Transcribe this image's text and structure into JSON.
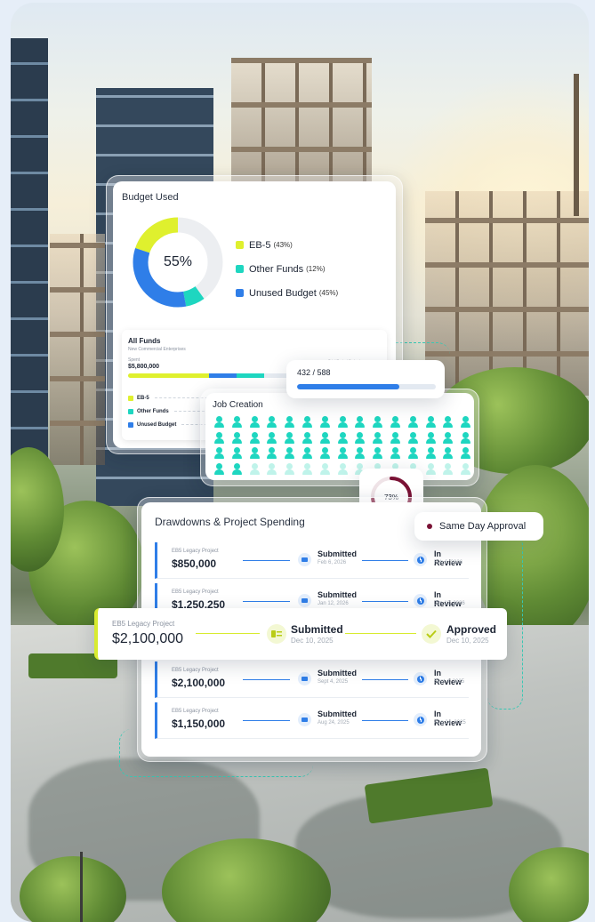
{
  "colors": {
    "eb5": "#dff02e",
    "other_funds": "#1ed6c0",
    "unused": "#2f7ee8",
    "donut_track": "#eceef1",
    "ring_progress": "#7a1235",
    "approved_accent": "#d8eb2f"
  },
  "budget": {
    "title": "Budget Used",
    "center_label": "55%",
    "legend": [
      {
        "label": "EB-5",
        "pct": "(43%)",
        "value": 43,
        "color": "#dff02e"
      },
      {
        "label": "Other Funds",
        "pct": "(12%)",
        "value": 12,
        "color": "#1ed6c0"
      },
      {
        "label": "Unused Budget",
        "pct": "(45%)",
        "value": 45,
        "color": "#2f7ee8"
      }
    ]
  },
  "all_funds": {
    "title": "All Funds",
    "subtitle": "New Commercial Enterprises",
    "spent_label": "Spent",
    "spent_amount": "$5,800,000",
    "total_label": "Total Project Budget",
    "legend": [
      "EB-5",
      "Other Funds",
      "Unused Budget"
    ]
  },
  "progress": {
    "label": "432 / 588",
    "current": 432,
    "total": 588
  },
  "job_creation": {
    "title": "Job Creation",
    "rows": 4,
    "cols": 15,
    "filled": 47
  },
  "ring": {
    "label": "73%",
    "value": 73
  },
  "same_day": {
    "label": "Same Day Approval"
  },
  "drawdowns": {
    "title": "Drawdowns & Project Spending",
    "entries": [
      {
        "project": "EB5 Legacy Project",
        "amount": "$850,000",
        "status1": "Submitted",
        "date1": "Feb 6, 2026",
        "status2": "In Review",
        "date2": "Feb 6, 2026"
      },
      {
        "project": "EB5 Legacy Project",
        "amount": "$1,250,250",
        "status1": "Submitted",
        "date1": "Jan 12, 2026",
        "status2": "In Review",
        "date2": "Jan 12, 2026"
      },
      {
        "project": "EB5 Legacy Project",
        "amount": "$2,100,000",
        "status1": "Submitted",
        "date1": "Sept 4, 2025",
        "status2": "In Review",
        "date2": "Sept 4, 2025"
      },
      {
        "project": "EB5 Legacy Project",
        "amount": "$1,150,000",
        "status1": "Submitted",
        "date1": "Aug 24, 2025",
        "status2": "In Review",
        "date2": "Aug 24, 2025"
      }
    ]
  },
  "highlight": {
    "project": "EB5 Legacy Project",
    "amount": "$2,100,000",
    "status1": "Submitted",
    "date1": "Dec 10, 2025",
    "status2": "Approved",
    "date2": "Dec 10, 2025"
  },
  "icons": {
    "document": "document-icon",
    "clock": "clock-icon",
    "check": "check-icon",
    "person": "person-icon"
  }
}
